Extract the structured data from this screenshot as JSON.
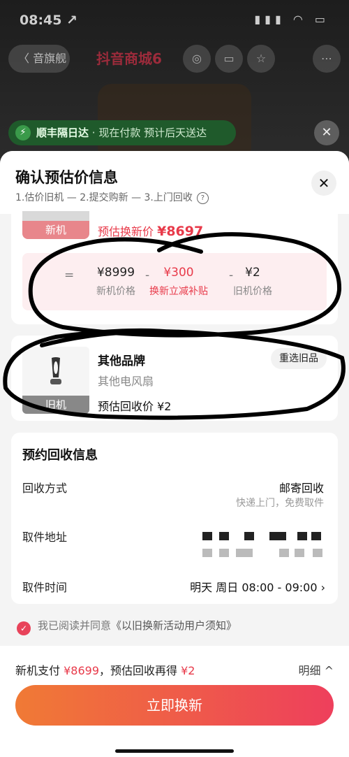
{
  "status_bar": {
    "time": "08:45 ↗",
    "icons": "▮▮▮ ◠ ▭"
  },
  "background": {
    "back_label": "〈 音旗舰",
    "store_title": "抖音商城6",
    "delivery_banner": {
      "bold": "顺丰隔日达",
      "text": " · 现在付款 预计后天送达"
    },
    "close_icon": "✕",
    "buttons": [
      "◎",
      "▭",
      "☆",
      "⋯"
    ]
  },
  "sheet": {
    "title": "确认预估价信息",
    "steps": "1.估价旧机 — 2.提交购新 — 3.上门回收",
    "help_icon": "?",
    "close_icon": "✕"
  },
  "new_item": {
    "tag": "新机",
    "estimate_label": "预估换新价 ",
    "estimate_value": "¥8697",
    "calc": {
      "equals": "=",
      "minus": "-",
      "new_price": "¥8999",
      "new_price_label": "新机价格",
      "subsidy": "¥300",
      "subsidy_label": "换新立减补贴",
      "old_price": "¥2",
      "old_price_label": "旧机价格"
    }
  },
  "old_item": {
    "tag": "旧机",
    "brand": "其他品牌",
    "model": "其他电风扇",
    "estimate": "预估回收价 ¥2",
    "reselect": "重选旧品"
  },
  "recycle_info": {
    "title": "预约回收信息",
    "method_label": "回收方式",
    "method_value": "邮寄回收",
    "method_sub": "快递上门，免费取件",
    "address_label": "取件地址",
    "time_label": "取件时间",
    "time_value": "明天 周日 08:00 - 09:00 ›"
  },
  "agreement": {
    "check": "✓",
    "text": "我已阅读并同意",
    "link": "《以旧换新活动用户须知》"
  },
  "bottom": {
    "pay_prefix": "新机支付 ",
    "pay_value": "¥8699",
    "recycle_prefix": "，预估回收再得 ",
    "recycle_value": "¥2",
    "detail": "明细 ^",
    "button": "立即换新"
  }
}
